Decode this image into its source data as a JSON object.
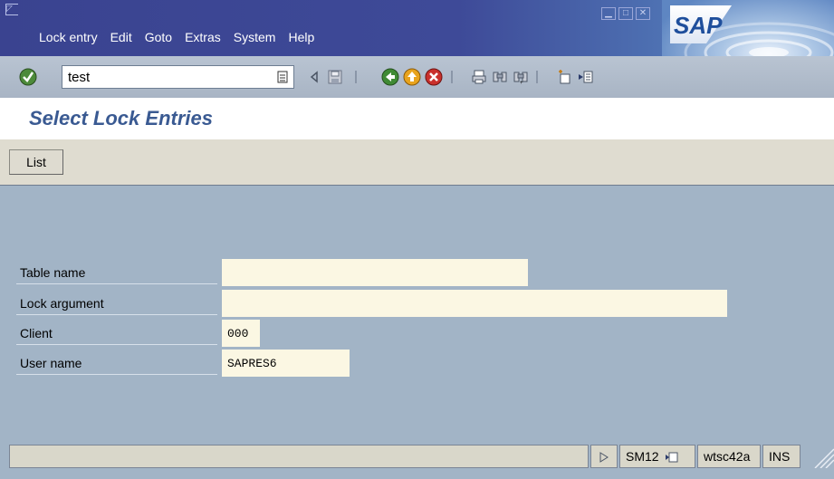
{
  "menu": {
    "items": [
      {
        "label": "Lock entry"
      },
      {
        "label": "Edit"
      },
      {
        "label": "Goto"
      },
      {
        "label": "Extras"
      },
      {
        "label": "System"
      },
      {
        "label": "Help"
      }
    ],
    "logo_text": "SAP"
  },
  "toolbar": {
    "command_value": "test"
  },
  "page": {
    "title": "Select Lock Entries"
  },
  "app_toolbar": {
    "list_label": "List"
  },
  "form": {
    "table_name": {
      "label": "Table name",
      "value": ""
    },
    "lock_argument": {
      "label": "Lock argument",
      "value": ""
    },
    "client": {
      "label": "Client",
      "value": "000"
    },
    "user_name": {
      "label": "User name",
      "value": "SAPRES6"
    }
  },
  "status": {
    "transaction": "SM12",
    "server": "wtsc42a",
    "mode": "INS"
  },
  "colors": {
    "menubar": "#3e4a98",
    "body": "#a2b4c6",
    "title": "#3a5a92",
    "field_bg": "#fbf7e3"
  }
}
